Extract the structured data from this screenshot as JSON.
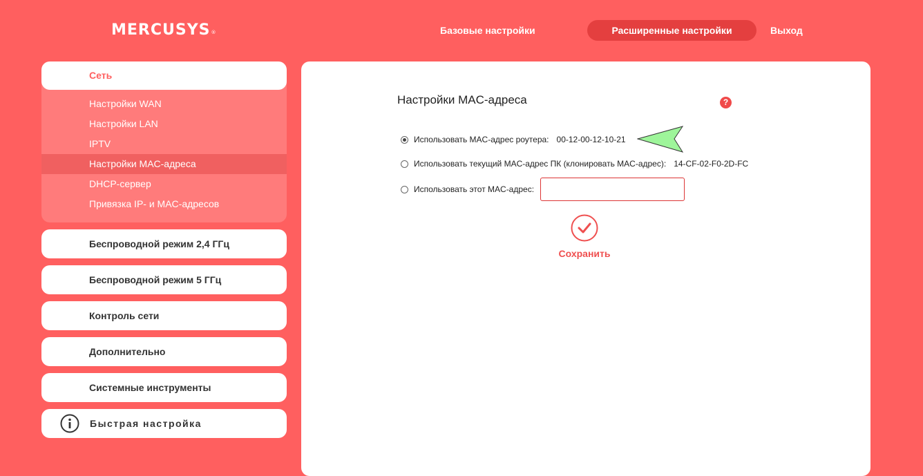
{
  "header": {
    "logo_text": "MERCUSYS",
    "logo_mark": "®",
    "nav": {
      "basic": "Базовые настройки",
      "advanced": "Расширенные настройки",
      "logout": "Выход"
    }
  },
  "sidebar": {
    "network": {
      "label": "Сеть",
      "items": [
        {
          "label": "Настройки WAN"
        },
        {
          "label": "Настройки LAN"
        },
        {
          "label": "IPTV"
        },
        {
          "label": "Настройки MAC-адреса"
        },
        {
          "label": "DHCP-сервер"
        },
        {
          "label": "Привязка IP- и MAC-адресов"
        }
      ],
      "active_item": "Настройки MAC-адреса"
    },
    "sections": [
      {
        "label": "Беспроводной режим 2,4 ГГц"
      },
      {
        "label": "Беспроводной режим 5 ГГц"
      },
      {
        "label": "Контроль сети"
      },
      {
        "label": "Дополнительно"
      },
      {
        "label": "Системные инструменты"
      }
    ],
    "quick_setup": {
      "label": "Быстрая настройка",
      "icon": "info-circle-icon"
    }
  },
  "content": {
    "title": "Настройки MAC-адреса",
    "help_icon": "question-mark-icon",
    "options": [
      {
        "label": "Использовать MAC-адрес роутера:",
        "value": "00-12-00-12-10-21",
        "checked": true
      },
      {
        "label": "Использовать текущий MAC-адрес ПК (клонировать MAC-адрес):",
        "value": "14-CF-02-F0-2D-FC",
        "checked": false
      },
      {
        "label": "Использовать этот MAC-адрес:",
        "checked": false
      }
    ],
    "custom_mac_value": "",
    "custom_mac_placeholder": "",
    "save_label": "Сохранить",
    "save_icon": "check-circle-icon"
  },
  "colors": {
    "background": "#ff5f5f",
    "active_nav": "#e43f3f",
    "submenu": "#ff7b7b",
    "submenu_active": "#f06060",
    "accent_red": "#ef4f4f",
    "annotation_arrow": "#9ef59a"
  }
}
